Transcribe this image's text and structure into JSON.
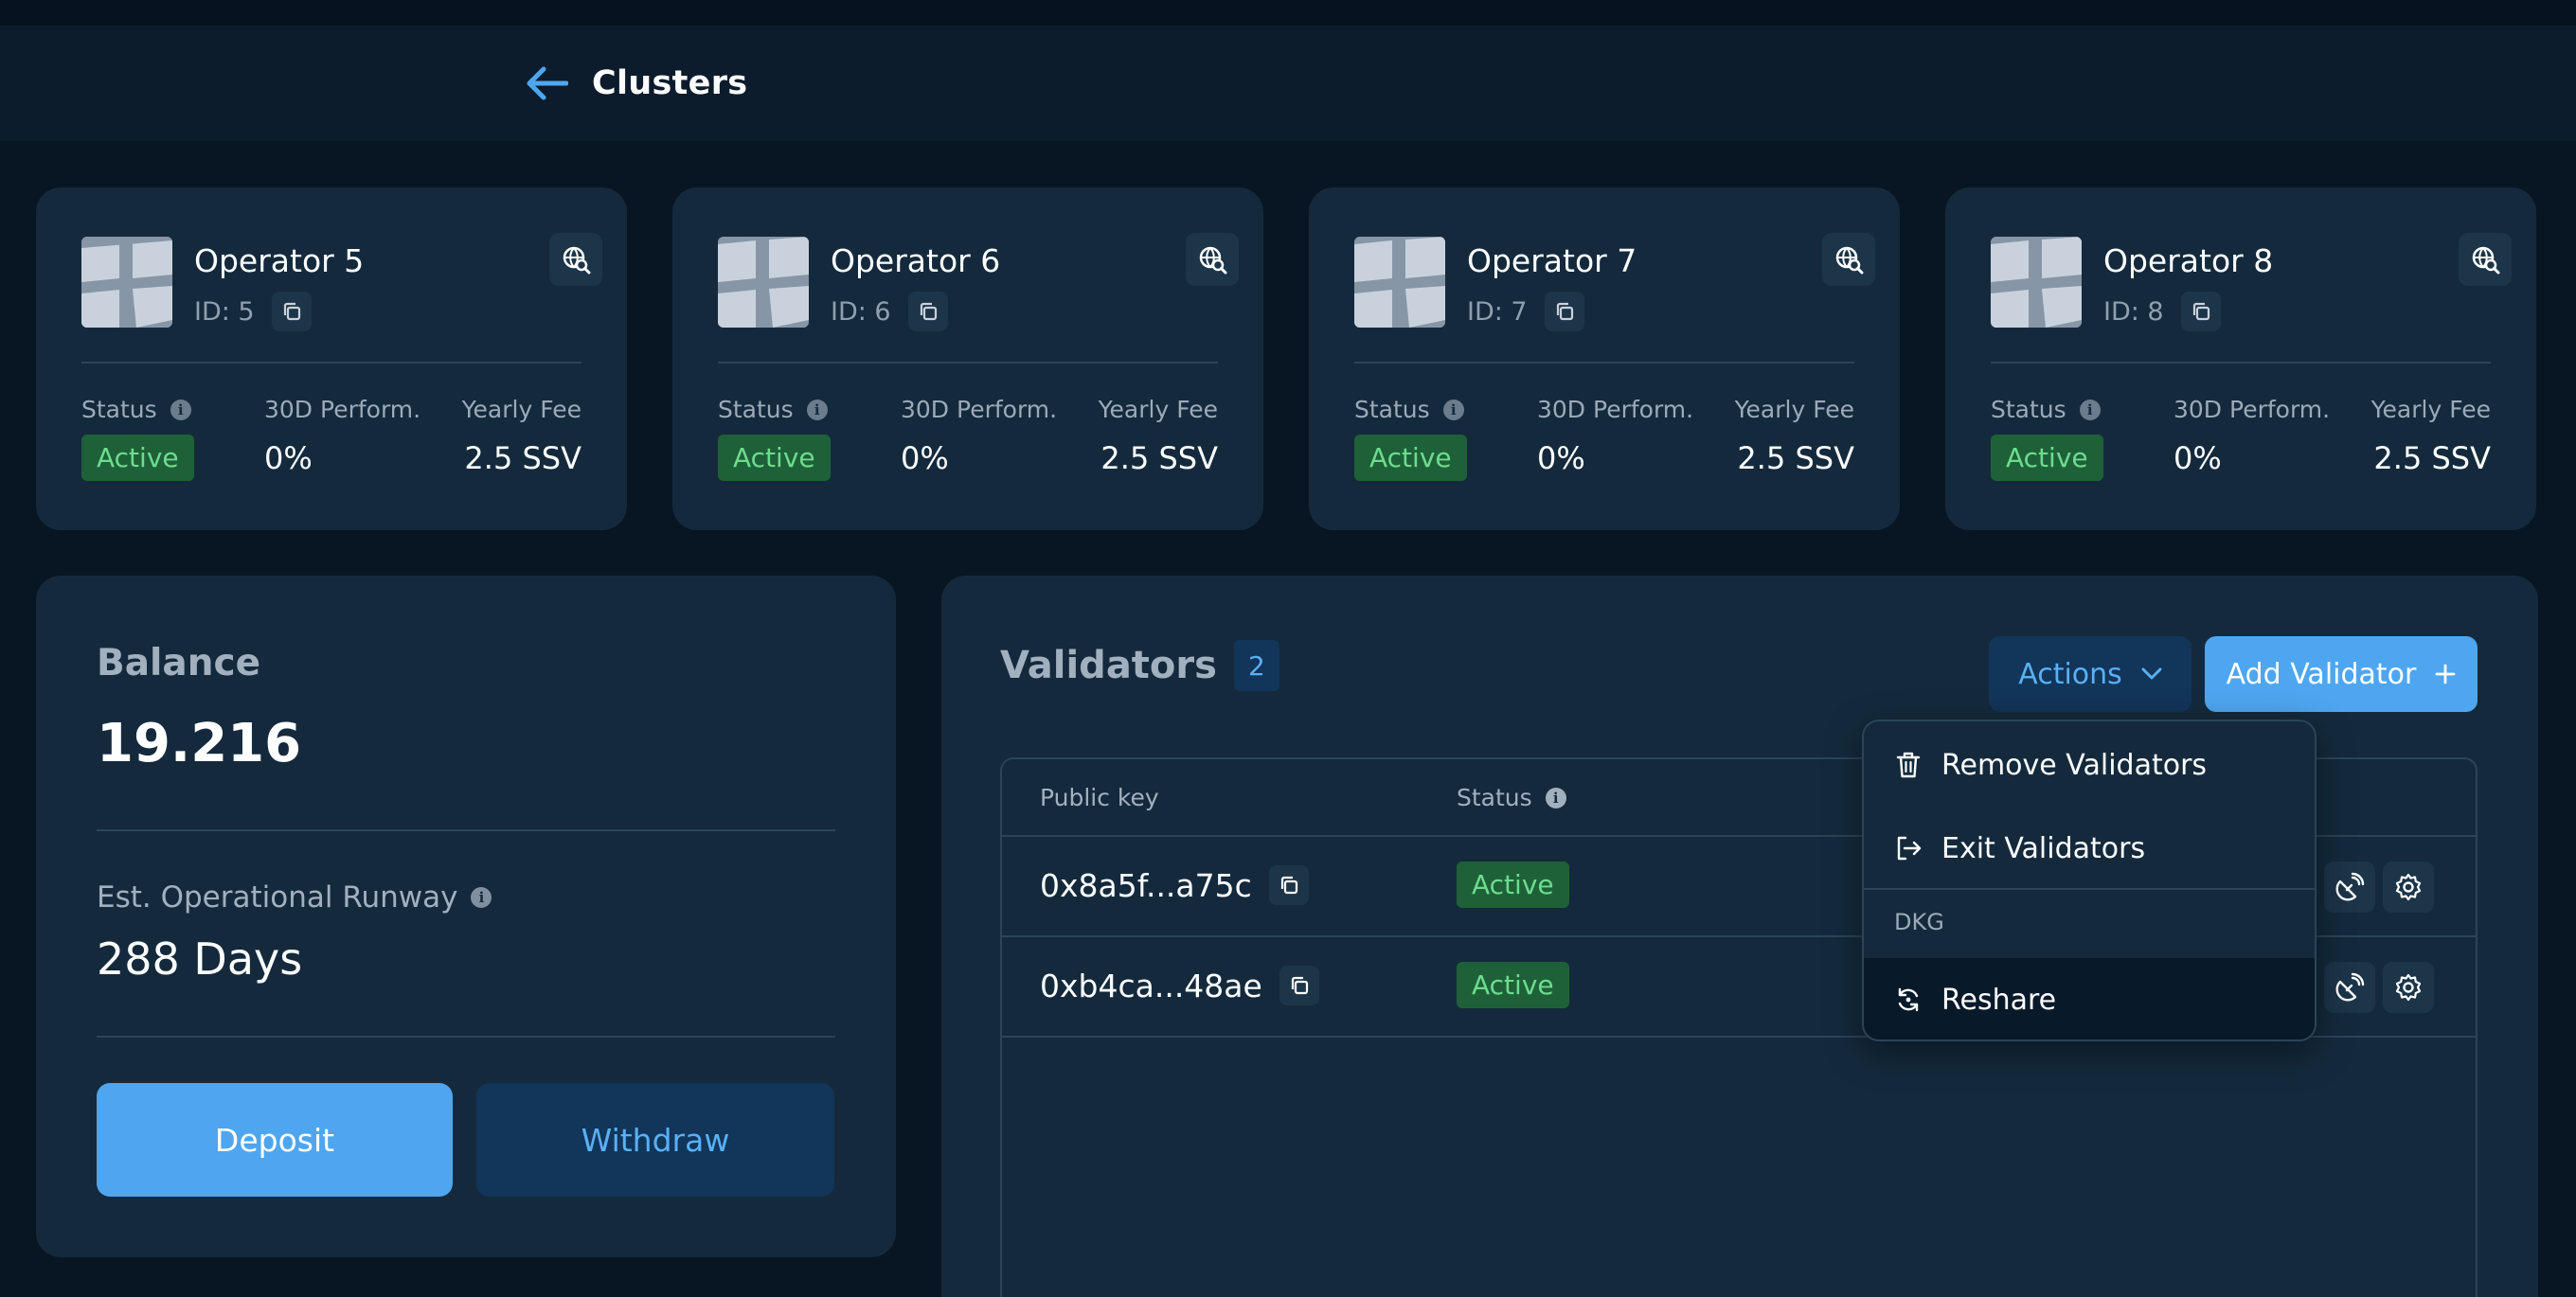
{
  "header": {
    "title": "Clusters"
  },
  "operators": [
    {
      "name": "Operator 5",
      "id_label": "ID: 5",
      "status_label": "Status",
      "status": "Active",
      "perf_label": "30D Perform.",
      "perf": "0%",
      "fee_label": "Yearly Fee",
      "fee": "2.5 SSV"
    },
    {
      "name": "Operator 6",
      "id_label": "ID: 6",
      "status_label": "Status",
      "status": "Active",
      "perf_label": "30D Perform.",
      "perf": "0%",
      "fee_label": "Yearly Fee",
      "fee": "2.5 SSV"
    },
    {
      "name": "Operator 7",
      "id_label": "ID: 7",
      "status_label": "Status",
      "status": "Active",
      "perf_label": "30D Perform.",
      "perf": "0%",
      "fee_label": "Yearly Fee",
      "fee": "2.5 SSV"
    },
    {
      "name": "Operator 8",
      "id_label": "ID: 8",
      "status_label": "Status",
      "status": "Active",
      "perf_label": "30D Perform.",
      "perf": "0%",
      "fee_label": "Yearly Fee",
      "fee": "2.5 SSV"
    }
  ],
  "balance": {
    "label": "Balance",
    "value": "19.216",
    "runway_label": "Est. Operational Runway",
    "runway_value": "288 Days",
    "deposit_label": "Deposit",
    "withdraw_label": "Withdraw"
  },
  "validators": {
    "title": "Validators",
    "count": "2",
    "actions_label": "Actions",
    "add_label": "Add Validator",
    "columns": {
      "public_key": "Public key",
      "status": "Status"
    },
    "rows": [
      {
        "public_key": "0x8a5f...a75c",
        "status": "Active"
      },
      {
        "public_key": "0xb4ca...48ae",
        "status": "Active"
      }
    ]
  },
  "actions_menu": {
    "remove": "Remove Validators",
    "exit": "Exit Validators",
    "group_label": "DKG",
    "reshare": "Reshare"
  },
  "icons": {
    "back": "arrow-left-icon",
    "copy": "copy-icon",
    "explorer": "globe-search-icon",
    "info": "info-icon",
    "trash": "trash-icon",
    "exit": "exit-icon",
    "reshare": "refresh-icon",
    "beacon": "satellite-dish-icon",
    "settings": "gear-icon"
  },
  "colors": {
    "accent": "#4EA6F0",
    "active_badge_bg": "#1E6138",
    "active_badge_text": "#6DDC8F"
  }
}
